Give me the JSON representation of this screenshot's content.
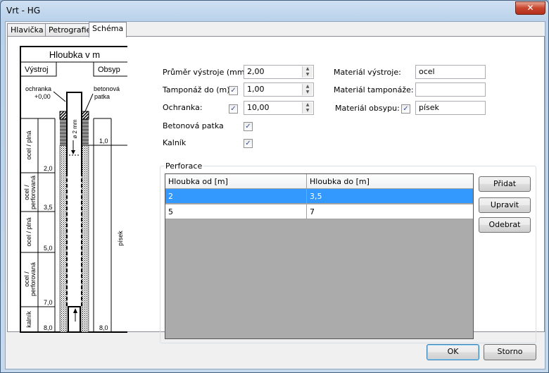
{
  "window": {
    "title": "Vrt - HG",
    "close": "✕"
  },
  "tabs": [
    "Hlavička",
    "Petrografie",
    "Schéma"
  ],
  "schema": {
    "title": "Hloubka v m",
    "left_header": "Výstroj",
    "right_header": "Obsyp",
    "ochranka": "ochranka",
    "ochranka_value": "+0,00",
    "betonova": "betonová",
    "patka": "patka",
    "diameter": "ø 2 mm",
    "layers": [
      {
        "label": "ocel / plná",
        "depth": "2,0"
      },
      {
        "label": "ocel / perforovaná",
        "depth": "3,5"
      },
      {
        "label": "ocel / plná",
        "depth": "5,0"
      },
      {
        "label": "ocel / perforovaná",
        "depth": "7,0"
      },
      {
        "label": "kalník",
        "depth": "8,0"
      }
    ],
    "obsyp": {
      "top_depth": "1,0",
      "label": "písek",
      "bottom_depth": "8,0"
    }
  },
  "form": {
    "prumer": {
      "label": "Průměr výstroje (mm):",
      "value": "2,00"
    },
    "tamponaz": {
      "label": "Tamponáž do (m):",
      "checked": true,
      "value": "1,00"
    },
    "ochranka": {
      "label": "Ochranka:",
      "checked": true,
      "value": "10,00"
    },
    "betonova": {
      "label": "Betonová patka",
      "checked": true
    },
    "kalnik": {
      "label": "Kalník",
      "checked": true
    },
    "mat_vystroje": {
      "label": "Materiál výstroje:",
      "value": "ocel"
    },
    "mat_tamponaze": {
      "label": "Materiál tamponáže:",
      "value": ""
    },
    "mat_obsypu": {
      "label": "Materiál obsypu:",
      "checked": true,
      "value": "písek"
    }
  },
  "perforace": {
    "title": "Perforace",
    "columns": [
      "Hloubka od [m]",
      "Hloubka do [m]"
    ],
    "rows": [
      [
        "2",
        "3,5"
      ],
      [
        "5",
        "7"
      ]
    ],
    "selected_row": 0,
    "buttons": {
      "add": "Přidat",
      "edit": "Upravit",
      "remove": "Odebrat"
    }
  },
  "footer": {
    "ok": "OK",
    "cancel": "Storno"
  },
  "check": "✓"
}
